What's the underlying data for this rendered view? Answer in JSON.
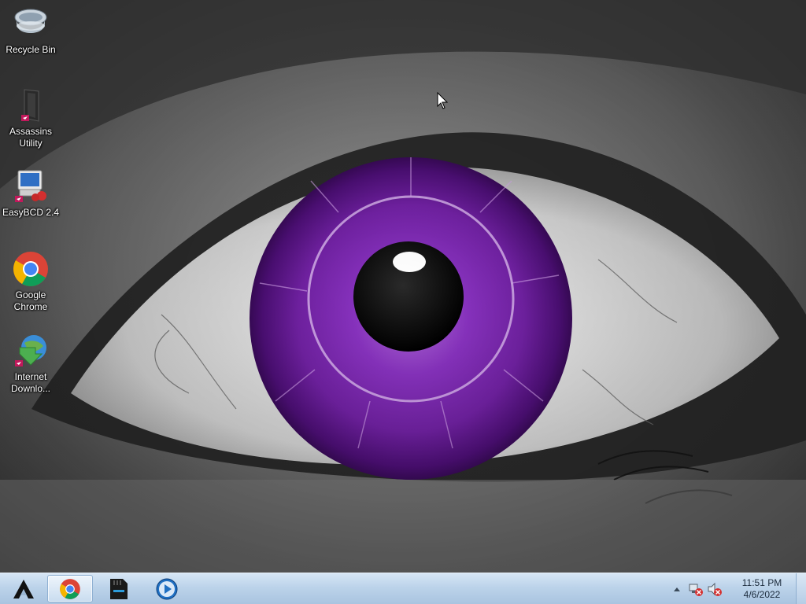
{
  "desktop": {
    "icons": [
      {
        "label": "Recycle Bin",
        "icon": "recycle-bin-icon"
      },
      {
        "label": "Assassins\nUtility",
        "icon": "assassins-utility-icon"
      },
      {
        "label": "EasyBCD 2.4",
        "icon": "easybcd-icon"
      },
      {
        "label": "Google\nChrome",
        "icon": "chrome-icon"
      },
      {
        "label": "Internet\nDownlo...",
        "icon": "internet-download-manager-icon"
      }
    ]
  },
  "taskbar": {
    "pinned": [
      {
        "name": "start",
        "icon": "start-logo-icon"
      },
      {
        "name": "Google Chrome",
        "icon": "chrome-icon",
        "active": true
      },
      {
        "name": "SD drive",
        "icon": "sd-card-icon"
      },
      {
        "name": "Media Player",
        "icon": "media-play-icon"
      }
    ],
    "tray": {
      "icons": [
        "show-hidden-icons-chevron",
        "network-error-icon",
        "volume-muted-icon"
      ]
    },
    "clock": {
      "time": "11:51 PM",
      "date": "4/6/2022"
    }
  },
  "colors": {
    "iris": "#7d2bb0",
    "taskbar": "#bcd3ea"
  }
}
